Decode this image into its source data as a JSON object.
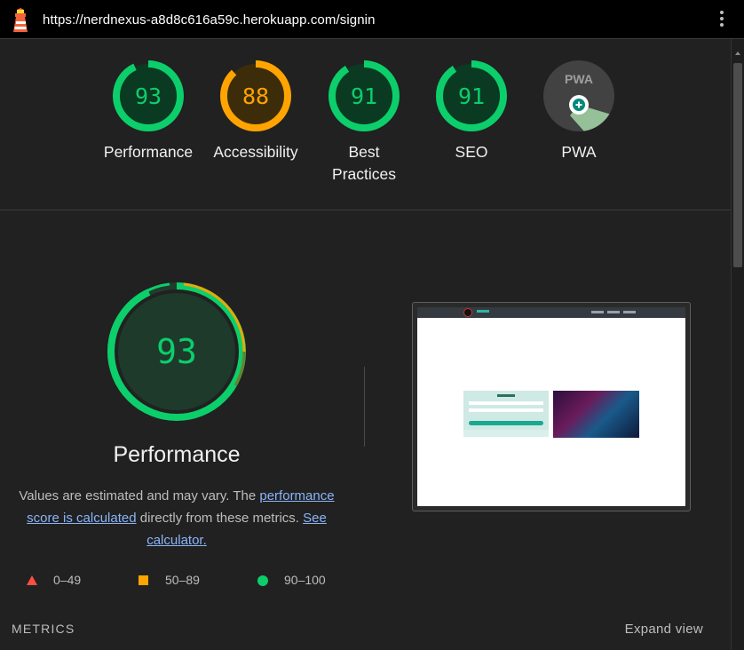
{
  "topbar": {
    "url": "https://nerdnexus-a8d8c616a59c.herokuapp.com/signin",
    "logo_icon": "lighthouse-icon",
    "menu_icon": "more-vert-icon"
  },
  "gauges": [
    {
      "score": "93",
      "label": "Performance",
      "status": "pass",
      "fraction": 0.93
    },
    {
      "score": "88",
      "label": "Accessibility",
      "status": "average",
      "fraction": 0.88
    },
    {
      "score": "91",
      "label": "Best Practices",
      "status": "pass",
      "fraction": 0.91
    },
    {
      "score": "91",
      "label": "SEO",
      "status": "pass",
      "fraction": 0.91
    },
    {
      "score": "",
      "label": "PWA",
      "status": "pwa",
      "fraction": 0
    }
  ],
  "pwa_badge_text": "PWA",
  "performance": {
    "score": "93",
    "fraction": 0.93,
    "title": "Performance",
    "desc_prefix": "Values are estimated and may vary. The ",
    "desc_link": "performance score is calculated",
    "desc_middle": " directly from these metrics. ",
    "calc_link": "See calculator."
  },
  "legend": [
    {
      "range": "0–49",
      "shape": "triangle",
      "color": "#ff4e42"
    },
    {
      "range": "50–89",
      "shape": "square",
      "color": "#ffa400"
    },
    {
      "range": "90–100",
      "shape": "circle",
      "color": "#0cce6b"
    }
  ],
  "metrics": {
    "heading": "METRICS",
    "expand_label": "Expand view"
  },
  "colors": {
    "pass": "#0cce6b",
    "pass_bg": "#0b3a23",
    "average": "#ffa400",
    "average_bg": "#3d2c0a",
    "fail": "#ff4e42",
    "page_bg": "#212121"
  }
}
